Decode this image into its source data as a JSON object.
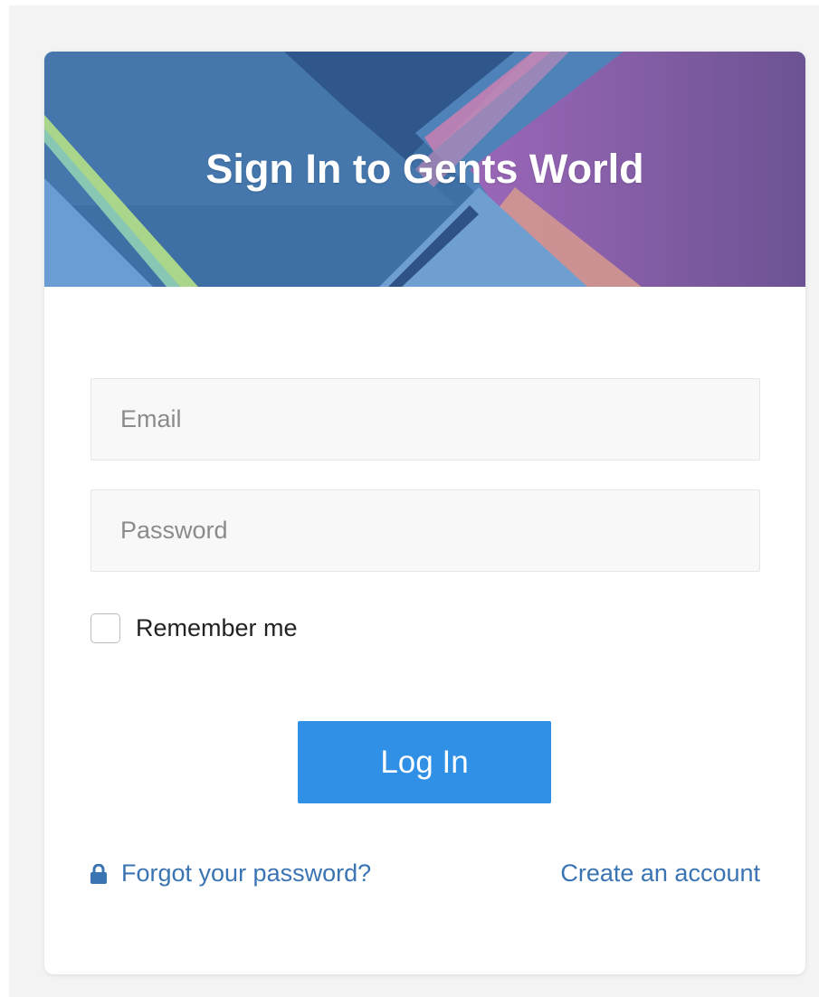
{
  "header": {
    "title": "Sign In to Gents World"
  },
  "form": {
    "email": {
      "value": "",
      "placeholder": "Email"
    },
    "password": {
      "value": "",
      "placeholder": "Password"
    },
    "remember": {
      "label": "Remember me",
      "checked": false
    },
    "submit_label": "Log In"
  },
  "links": {
    "forgot_password": "Forgot your password?",
    "create_account": "Create an account"
  },
  "icons": {
    "forgot_icon": "lock-icon"
  },
  "colors": {
    "primary_button": "#2f90e6",
    "link": "#3a74b3",
    "page_background": "#f3f3f3",
    "banner_blue": "#3f6fa6",
    "banner_purple": "#8b62ad"
  }
}
